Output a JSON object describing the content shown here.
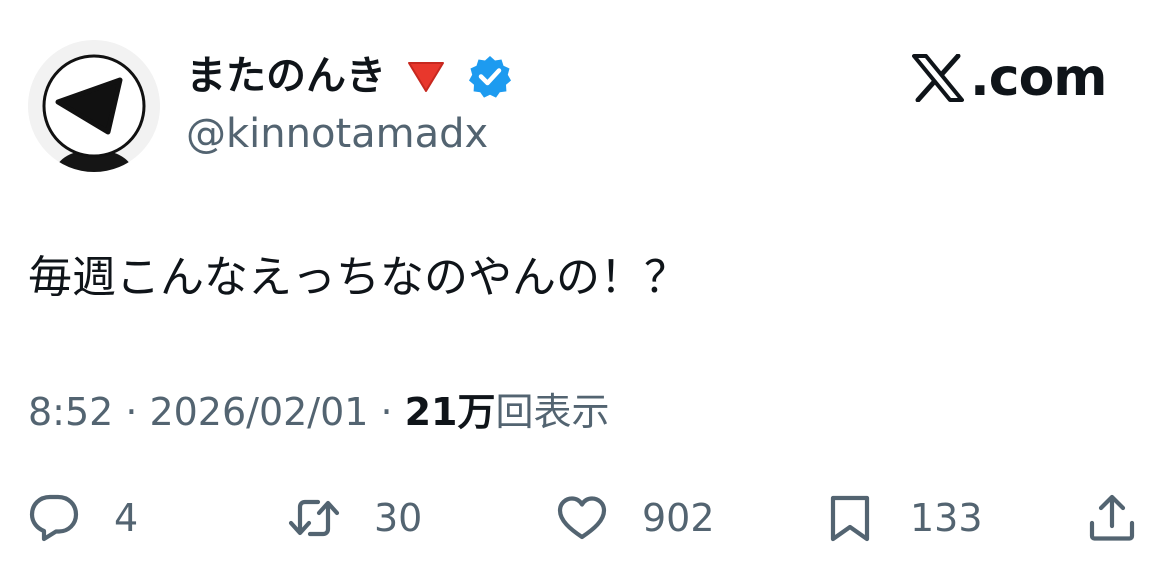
{
  "author": {
    "display_name": "またのんき",
    "handle": "@kinnotamadx",
    "verified": true,
    "verified_color": "#1d9bf0",
    "name_marker_icon": "red-triangle-down-icon",
    "name_marker_color": "#e8372c"
  },
  "brand": {
    "text": ".com",
    "icon": "x-logo-icon"
  },
  "tweet": {
    "text": "毎週こんなえっちなのやんの！？"
  },
  "meta": {
    "time": "8:52",
    "separator": "·",
    "date": "2026/02/01",
    "views_count": "21万",
    "views_label": "回表示"
  },
  "actions": {
    "reply": {
      "icon": "reply-icon",
      "count": "4"
    },
    "retweet": {
      "icon": "retweet-icon",
      "count": "30"
    },
    "like": {
      "icon": "heart-icon",
      "count": "902"
    },
    "bookmark": {
      "icon": "bookmark-icon",
      "count": "133"
    },
    "share": {
      "icon": "share-icon"
    }
  },
  "colors": {
    "text_primary": "#0f1419",
    "text_secondary": "#536471"
  }
}
